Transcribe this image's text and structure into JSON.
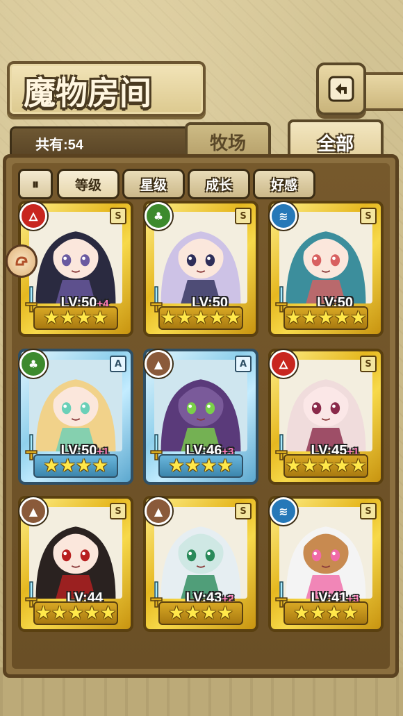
{
  "header": {
    "title": "魔物房间"
  },
  "count_label": "共有:54",
  "tabs": [
    {
      "label": "牧场",
      "active": false
    },
    {
      "label": "全部",
      "active": true
    }
  ],
  "sort": {
    "toggle_glyph": "⏸",
    "buttons": [
      {
        "label": "等级",
        "active": true
      },
      {
        "label": "星级",
        "active": false
      },
      {
        "label": "成长",
        "active": false
      },
      {
        "label": "好感",
        "active": false
      }
    ]
  },
  "monsters": [
    {
      "element": "fire",
      "rank": "S",
      "level": "LV:50",
      "plus": "+4",
      "stars": 4,
      "frame": "gold",
      "hair": "#2a2a40",
      "skin": "#fbe7dc",
      "accent": "#6a5aa0"
    },
    {
      "element": "wood",
      "rank": "S",
      "level": "LV:50",
      "plus": "",
      "stars": 5,
      "frame": "gold",
      "hair": "#cdc2e6",
      "skin": "#fbe7dc",
      "accent": "#2e2e5a"
    },
    {
      "element": "water",
      "rank": "S",
      "level": "LV:50",
      "plus": "",
      "stars": 5,
      "frame": "gold",
      "hair": "#3c8e9c",
      "skin": "#fbe7dc",
      "accent": "#d86060"
    },
    {
      "element": "wood",
      "rank": "A",
      "level": "LV:50",
      "plus": "+1",
      "stars": 4,
      "frame": "blue",
      "hair": "#f1d28a",
      "skin": "#fbe7dc",
      "accent": "#6ad0b8"
    },
    {
      "element": "earth",
      "rank": "A",
      "level": "LV:46",
      "plus": "+3",
      "stars": 4,
      "frame": "blue",
      "hair": "#5a3a7a",
      "skin": "#7a5a9a",
      "accent": "#7ad04a"
    },
    {
      "element": "fire",
      "rank": "S",
      "level": "LV:45",
      "plus": "+1",
      "stars": 5,
      "frame": "gold",
      "hair": "#f0dcdc",
      "skin": "#fbe7e7",
      "accent": "#8a2a4a"
    },
    {
      "element": "earth",
      "rank": "S",
      "level": "LV:44",
      "plus": "",
      "stars": 5,
      "frame": "gold",
      "hair": "#2a2220",
      "skin": "#fbe7dc",
      "accent": "#b82020"
    },
    {
      "element": "earth",
      "rank": "S",
      "level": "LV:43",
      "plus": "+2",
      "stars": 4,
      "frame": "gold",
      "hair": "#e6eef2",
      "skin": "#cfe8e4",
      "accent": "#2a8a5a"
    },
    {
      "element": "water",
      "rank": "S",
      "level": "LV:41",
      "plus": "+3",
      "stars": 4,
      "frame": "gold",
      "hair": "#f4f4f4",
      "skin": "#c88a50",
      "accent": "#f06aa8"
    }
  ]
}
